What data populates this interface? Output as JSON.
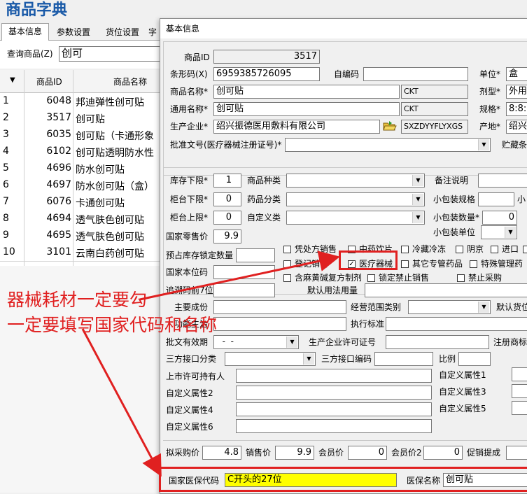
{
  "app": {
    "title": "商品字典",
    "tabs": [
      "基本信息",
      "参数设置",
      "货位设置",
      "字"
    ],
    "query_label": "查询商品(Z)",
    "query_value": "创可",
    "grid_headers": [
      "商品ID",
      "商品名称"
    ],
    "grid_rows": [
      {
        "idx": "1",
        "id": "6048",
        "name": "邦迪弹性创可贴"
      },
      {
        "idx": "2",
        "id": "3517",
        "name": "创可贴"
      },
      {
        "idx": "3",
        "id": "6035",
        "name": "创可贴（卡通形象"
      },
      {
        "idx": "4",
        "id": "6102",
        "name": "创可贴透明防水性"
      },
      {
        "idx": "5",
        "id": "4696",
        "name": "防水创可贴"
      },
      {
        "idx": "6",
        "id": "4697",
        "name": "防水创可贴（盒）"
      },
      {
        "idx": "7",
        "id": "6076",
        "name": "卡通创可贴"
      },
      {
        "idx": "8",
        "id": "4694",
        "name": "透气肤色创可贴"
      },
      {
        "idx": "9",
        "id": "4695",
        "name": "透气肤色创可贴"
      },
      {
        "idx": "10",
        "id": "3101",
        "name": "云南白药创可贴"
      }
    ]
  },
  "dialog": {
    "title": "基本信息",
    "product_id_label": "商品ID",
    "product_id": "3517",
    "barcode_label": "条形码(X)",
    "barcode": "6959385726095",
    "selfcode_label": "自编码",
    "unit_label": "单位*",
    "unit": "盒",
    "name_label": "商品名称*",
    "name": "创可贴",
    "name_code": "CKT",
    "form_label": "剂型*",
    "form": "外用",
    "common_label": "通用名称*",
    "common": "创可贴",
    "common_code": "CKT",
    "spec_label": "规格*",
    "spec": "8:8:",
    "maker_label": "生产企业*",
    "maker": "绍兴振德医用敷料有限公司",
    "maker_code": "SXZDYYFLYXGS",
    "origin_label": "产地*",
    "origin": "绍兴",
    "approval_label": "批准文号(医疗器械注册证号)*",
    "storage_label": "贮藏条",
    "stock_low_label": "库存下限*",
    "stock_low": "1",
    "category_label": "商品种类",
    "remark_label": "备注说明",
    "counter_low_label": "柜台下限*",
    "counter_low": "0",
    "drug_class_label": "药品分类",
    "small_pack_spec_label": "小包装规格",
    "small_cut": "小",
    "counter_high_label": "柜台上限*",
    "counter_high": "0",
    "custom_class_label": "自定义类",
    "small_pack_qty_label": "小包装数量*",
    "small_pack_qty": "0",
    "small_pack_unit_label": "小包装单位",
    "retail_label": "国家零售价",
    "retail": "9.9",
    "reserve_label": "预占库存锁定数量",
    "checks": {
      "rx": "凭处方销售",
      "herb": "中药饮片",
      "cold": "冷藏冷冻",
      "yin": "阴京",
      "import": "进口",
      "register": "登记销售",
      "device": "医疗器械",
      "other_drug": "其它专管药品",
      "special": "特殊管理药",
      "compound": "含麻黄碱复方制剂",
      "lock": "锁定禁止销售",
      "nobuy": "禁止采购",
      "check_mark": "✓"
    },
    "nat_code_label": "国家本位码",
    "trace_label": "追溯码前7位",
    "usage_label": "默认用法用量",
    "ingredient_label": "主要成份",
    "scope_label": "经营范围类别",
    "default_loc_label": "默认货位",
    "function_label": "功能主治",
    "standard_label": "执行标准",
    "validity_label": "批文有效期",
    "validity": "  -  -",
    "license_label": "生产企业许可证号",
    "trademark_label": "注册商标",
    "third_class_label": "三方接口分类",
    "third_code_label": "三方接口编码",
    "ratio_label": "比例",
    "mah_label": "上市许可持有人",
    "attr1_label": "自定义属性1",
    "attr2_label": "自定义属性2",
    "attr3_label": "自定义属性3",
    "attr4_label": "自定义属性4",
    "attr5_label": "自定义属性5",
    "attr6_label": "自定义属性6",
    "purchase_label": "拟采购价",
    "purchase": "4.8",
    "sale_label": "销售价",
    "sale": "9.9",
    "member_label": "会员价",
    "member": "0",
    "member2_label": "会员价2",
    "member2": "0",
    "promo_label": "促销提成",
    "insurance_code_label": "国家医保代码",
    "insurance_code": "C开头的27位",
    "insurance_name_label": "医保名称",
    "insurance_name": "创可贴"
  },
  "annotation": {
    "line1": "器械耗材一定要勾",
    "line2": "一定要填写国家代码和名称",
    "color": "#e02020"
  }
}
